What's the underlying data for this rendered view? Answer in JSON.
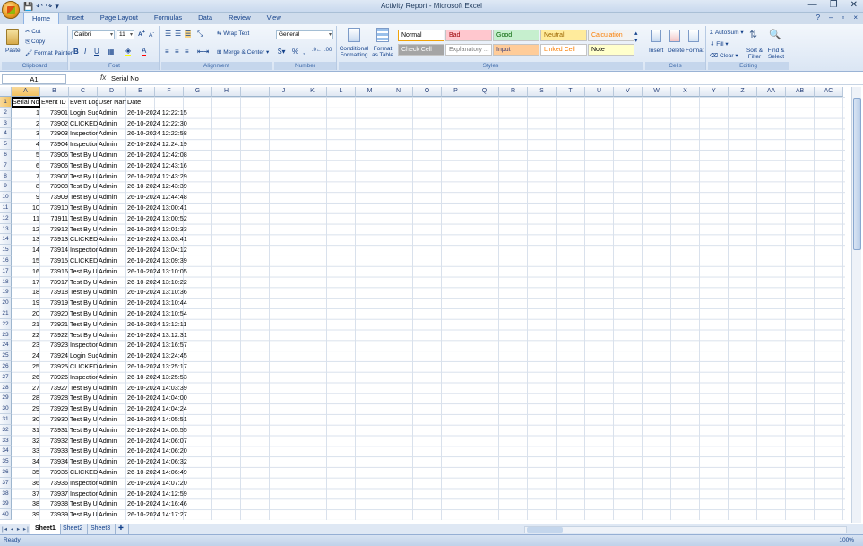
{
  "window": {
    "title": "Activity Report - Microsoft Excel"
  },
  "qat": {
    "save_icon": "save-icon",
    "undo_icon": "undo-icon",
    "redo_icon": "redo-icon"
  },
  "tabs": [
    "Home",
    "Insert",
    "Page Layout",
    "Formulas",
    "Data",
    "Review",
    "View"
  ],
  "ribbon": {
    "clipboard": {
      "paste": "Paste",
      "cut": "Cut",
      "copy": "Copy",
      "format_painter": "Format Painter",
      "label": "Clipboard"
    },
    "font": {
      "name": "Calibri",
      "size": "11",
      "label": "Font"
    },
    "alignment": {
      "wrap": "Wrap Text",
      "merge": "Merge & Center",
      "label": "Alignment"
    },
    "number": {
      "format": "General",
      "label": "Number"
    },
    "styles": {
      "conditional": "Conditional Formatting",
      "format_table": "Format as Table",
      "cells": [
        {
          "label": "Normal",
          "bg": "#ffffff",
          "fg": "#000000"
        },
        {
          "label": "Bad",
          "bg": "#ffc7ce",
          "fg": "#9c0006"
        },
        {
          "label": "Good",
          "bg": "#c6efce",
          "fg": "#006100"
        },
        {
          "label": "Neutral",
          "bg": "#ffeb9c",
          "fg": "#9c6500"
        },
        {
          "label": "Calculation",
          "bg": "#f2f2f2",
          "fg": "#fa7d00"
        },
        {
          "label": "Check Cell",
          "bg": "#a5a5a5",
          "fg": "#ffffff"
        },
        {
          "label": "Explanatory ...",
          "bg": "#ffffff",
          "fg": "#7f7f7f"
        },
        {
          "label": "Input",
          "bg": "#ffcc99",
          "fg": "#3f3f76"
        },
        {
          "label": "Linked Cell",
          "bg": "#ffffff",
          "fg": "#fa7d00"
        },
        {
          "label": "Note",
          "bg": "#ffffcc",
          "fg": "#000000"
        }
      ],
      "label": "Styles"
    },
    "cells": {
      "insert": "Insert",
      "delete": "Delete",
      "format": "Format",
      "label": "Cells"
    },
    "editing": {
      "autosum": "AutoSum",
      "fill": "Fill",
      "clear": "Clear",
      "sort": "Sort & Filter",
      "find": "Find & Select",
      "label": "Editing"
    }
  },
  "formula_bar": {
    "name_box": "A1",
    "fx": "fx",
    "formula": "Serial No"
  },
  "columns": [
    "A",
    "B",
    "C",
    "D",
    "E",
    "F",
    "G",
    "H",
    "I",
    "J",
    "K",
    "L",
    "M",
    "N",
    "O",
    "P",
    "Q",
    "R",
    "S",
    "T",
    "U",
    "V",
    "W",
    "X",
    "Y",
    "Z",
    "AA",
    "AB",
    "AC"
  ],
  "headers": [
    "Serial No",
    "Event ID",
    "Event Log",
    "User Nam",
    "Date"
  ],
  "rows": [
    [
      "1",
      "73901",
      "Login Succ",
      "Admin",
      "26-10-2024 12:22:15"
    ],
    [
      "2",
      "73902",
      "CLICKED C",
      "Admin",
      "26-10-2024 12:22:30"
    ],
    [
      "3",
      "73903",
      "Inspection",
      "Admin",
      "26-10-2024 12:22:58"
    ],
    [
      "4",
      "73904",
      "Inspection",
      "Admin",
      "26-10-2024 12:24:19"
    ],
    [
      "5",
      "73905",
      "Test By Us",
      "Admin",
      "26-10-2024 12:42:08"
    ],
    [
      "6",
      "73906",
      "Test By Us",
      "Admin",
      "26-10-2024 12:43:16"
    ],
    [
      "7",
      "73907",
      "Test By Us",
      "Admin",
      "26-10-2024 12:43:29"
    ],
    [
      "8",
      "73908",
      "Test By Us",
      "Admin",
      "26-10-2024 12:43:39"
    ],
    [
      "9",
      "73909",
      "Test By Us",
      "Admin",
      "26-10-2024 12:44:48"
    ],
    [
      "10",
      "73910",
      "Test By Us",
      "Admin",
      "26-10-2024 13:00:41"
    ],
    [
      "11",
      "73911",
      "Test By Us",
      "Admin",
      "26-10-2024 13:00:52"
    ],
    [
      "12",
      "73912",
      "Test By Us",
      "Admin",
      "26-10-2024 13:01:33"
    ],
    [
      "13",
      "73913",
      "CLICKED C",
      "Admin",
      "26-10-2024 13:03:41"
    ],
    [
      "14",
      "73914",
      "Inspection",
      "Admin",
      "26-10-2024 13:04:12"
    ],
    [
      "15",
      "73915",
      "CLICKED C",
      "Admin",
      "26-10-2024 13:09:39"
    ],
    [
      "16",
      "73916",
      "Test By Us",
      "Admin",
      "26-10-2024 13:10:05"
    ],
    [
      "17",
      "73917",
      "Test By Us",
      "Admin",
      "26-10-2024 13:10:22"
    ],
    [
      "18",
      "73918",
      "Test By Us",
      "Admin",
      "26-10-2024 13:10:36"
    ],
    [
      "19",
      "73919",
      "Test By Us",
      "Admin",
      "26-10-2024 13:10:44"
    ],
    [
      "20",
      "73920",
      "Test By Us",
      "Admin",
      "26-10-2024 13:10:54"
    ],
    [
      "21",
      "73921",
      "Test By Us",
      "Admin",
      "26-10-2024 13:12:11"
    ],
    [
      "22",
      "73922",
      "Test By Us",
      "Admin",
      "26-10-2024 13:12:31"
    ],
    [
      "23",
      "73923",
      "Inspection",
      "Admin",
      "26-10-2024 13:16:57"
    ],
    [
      "24",
      "73924",
      "Login Succ",
      "Admin",
      "26-10-2024 13:24:45"
    ],
    [
      "25",
      "73925",
      "CLICKED C",
      "Admin",
      "26-10-2024 13:25:17"
    ],
    [
      "26",
      "73926",
      "Inspection",
      "Admin",
      "26-10-2024 13:25:53"
    ],
    [
      "27",
      "73927",
      "Test By Us",
      "Admin",
      "26-10-2024 14:03:39"
    ],
    [
      "28",
      "73928",
      "Test By Us",
      "Admin",
      "26-10-2024 14:04:00"
    ],
    [
      "29",
      "73929",
      "Test By Us",
      "Admin",
      "26-10-2024 14:04:24"
    ],
    [
      "30",
      "73930",
      "Test By Us",
      "Admin",
      "26-10-2024 14:05:51"
    ],
    [
      "31",
      "73931",
      "Test By Us",
      "Admin",
      "26-10-2024 14:05:55"
    ],
    [
      "32",
      "73932",
      "Test By Us",
      "Admin",
      "26-10-2024 14:06:07"
    ],
    [
      "33",
      "73933",
      "Test By Us",
      "Admin",
      "26-10-2024 14:06:20"
    ],
    [
      "34",
      "73934",
      "Test By Us",
      "Admin",
      "26-10-2024 14:06:32"
    ],
    [
      "35",
      "73935",
      "CLICKED C",
      "Admin",
      "26-10-2024 14:06:49"
    ],
    [
      "36",
      "73936",
      "Inspection",
      "Admin",
      "26-10-2024 14:07:20"
    ],
    [
      "37",
      "73937",
      "Inspection",
      "Admin",
      "26-10-2024 14:12:59"
    ],
    [
      "38",
      "73938",
      "Test By Us",
      "Admin",
      "26-10-2024 14:16:46"
    ],
    [
      "39",
      "73939",
      "Test By Us",
      "Admin",
      "26-10-2024 14:17:27"
    ]
  ],
  "sheets": [
    "Sheet1",
    "Sheet2",
    "Sheet3"
  ],
  "status": {
    "text": "Ready",
    "zoom": "100%"
  }
}
